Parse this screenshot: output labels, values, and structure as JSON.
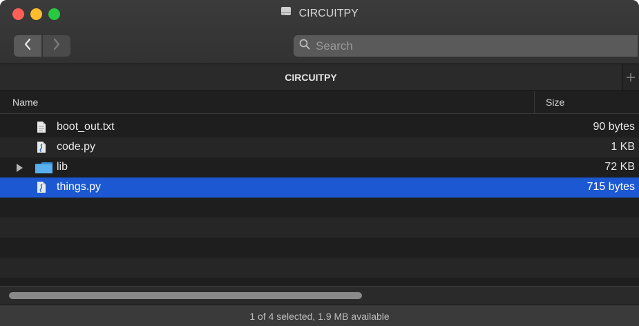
{
  "window": {
    "title": "CIRCUITPY"
  },
  "toolbar": {
    "back_icon": "chevron-left-icon",
    "forward_icon": "chevron-right-icon",
    "search_placeholder": "Search"
  },
  "tabs": [
    {
      "label": "CIRCUITPY"
    }
  ],
  "columns": {
    "name": "Name",
    "size": "Size"
  },
  "files": [
    {
      "name": "boot_out.txt",
      "size": "90 bytes",
      "icon": "text-file-icon",
      "selected": false,
      "expandable": false
    },
    {
      "name": "code.py",
      "size": "1 KB",
      "icon": "python-file-icon",
      "selected": false,
      "expandable": false
    },
    {
      "name": "lib",
      "size": "72 KB",
      "icon": "folder-icon",
      "selected": false,
      "expandable": true
    },
    {
      "name": "things.py",
      "size": "715 bytes",
      "icon": "python-file-icon",
      "selected": true,
      "expandable": false
    }
  ],
  "status": {
    "text": "1 of 4 selected, 1.9 MB available"
  },
  "colors": {
    "selection": "#1b58d2",
    "close": "#fe5f57",
    "minimize": "#febc2e",
    "maximize": "#28c840",
    "folder": "#4aa3e0"
  }
}
